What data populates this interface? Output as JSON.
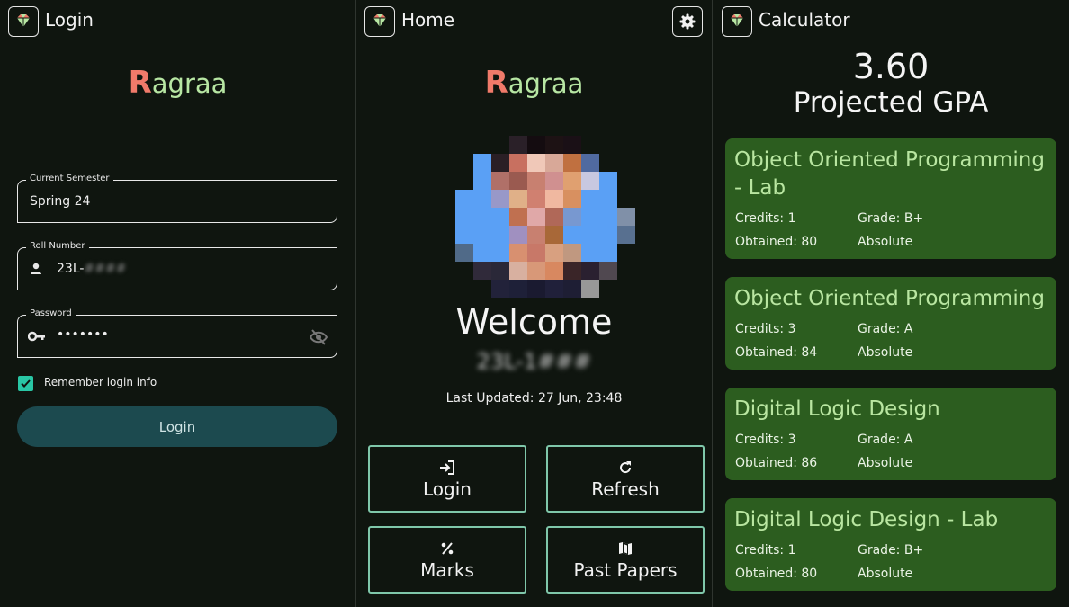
{
  "login": {
    "title": "Login",
    "brand_r": "R",
    "brand_rest": "agraa",
    "semester_label": "Current Semester",
    "semester_value": "Spring 24",
    "roll_label": "Roll Number",
    "roll_prefix": "23L-",
    "roll_hidden": "####",
    "password_label": "Password",
    "password_value": "•••••••",
    "remember_label": "Remember login info",
    "login_button": "Login"
  },
  "home": {
    "title": "Home",
    "brand_r": "R",
    "brand_rest": "agraa",
    "welcome": "Welcome",
    "name_hidden": "23L-1###",
    "updated": "Last Updated: 27 Jun, 23:48",
    "tiles": [
      {
        "label": "Login",
        "icon": "login-icon"
      },
      {
        "label": "Refresh",
        "icon": "refresh-icon"
      },
      {
        "label": "Marks",
        "icon": "percent-icon"
      },
      {
        "label": "Past Papers",
        "icon": "map-icon"
      }
    ]
  },
  "calc": {
    "title": "Calculator",
    "gpa": "3.60",
    "gpa_label": "Projected GPA",
    "courses": [
      {
        "title": "Object Oriented Programming - Lab",
        "credits": "Credits: 1",
        "grade": "Grade: B+",
        "obtained": "Obtained: 80",
        "type": "Absolute"
      },
      {
        "title": "Object Oriented Programming",
        "credits": "Credits: 3",
        "grade": "Grade: A",
        "obtained": "Obtained: 84",
        "type": "Absolute"
      },
      {
        "title": "Digital Logic Design",
        "credits": "Credits: 3",
        "grade": "Grade: A",
        "obtained": "Obtained: 86",
        "type": "Absolute"
      },
      {
        "title": "Digital Logic Design - Lab",
        "credits": "Credits: 1",
        "grade": "Grade: B+",
        "obtained": "Obtained: 80",
        "type": "Absolute"
      }
    ]
  },
  "colors": {
    "background": "#0f150f",
    "brand_green": "#b7e6a3",
    "brand_red": "#f07a6a",
    "card": "#2c5d1f",
    "button": "#1c4a4f",
    "checkbox": "#29c7a5",
    "tile_border": "#7fc7aa"
  }
}
